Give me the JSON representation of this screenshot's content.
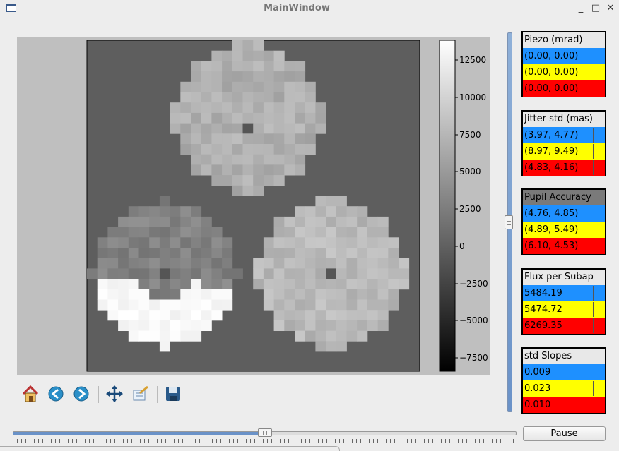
{
  "window": {
    "title": "MainWindow",
    "minimize": "_",
    "maximize": "□",
    "close": "✕"
  },
  "colorbar": {
    "ticks": [
      "12500",
      "10000",
      "7500",
      "5000",
      "2500",
      "0",
      "−2500",
      "−5000",
      "−7500"
    ]
  },
  "toolbar": [
    "home-icon",
    "back-icon",
    "forward-icon",
    "pan-icon",
    "configure-subplots-icon",
    "save-icon"
  ],
  "panels": [
    {
      "header": "Piezo (mrad)",
      "rows": [
        "(0.00, 0.00)",
        "(0.00, 0.00)",
        "(0.00, 0.00)"
      ],
      "marks": [
        null,
        null,
        null
      ],
      "dark_header": false
    },
    {
      "header": "Jitter std (mas)",
      "rows": [
        "(3.97, 4.77)",
        "(8.97, 9.49)",
        "(4.83, 4.16)"
      ],
      "marks": [
        0.85,
        0.85,
        0.85
      ],
      "dark_header": false
    },
    {
      "header": "Pupil Accuracy",
      "rows": [
        "(4.76, 4.85)",
        "(4.89, 5.49)",
        "(6.10, 4.53)"
      ],
      "marks": [
        null,
        null,
        null
      ],
      "dark_header": true
    },
    {
      "header": "Flux per Subap",
      "rows": [
        "5484.19",
        "5474.72",
        "6269.35"
      ],
      "marks": [
        0.85,
        0.85,
        0.85
      ],
      "dark_header": false
    },
    {
      "header": "std Slopes",
      "rows": [
        "0.009",
        "0.023",
        "0.010"
      ],
      "marks": [
        null,
        0.85,
        null
      ],
      "dark_header": false
    }
  ],
  "pause_button": "Pause",
  "sliders": {
    "vertical_value": 0.5,
    "horizontal_value": 0.5
  }
}
